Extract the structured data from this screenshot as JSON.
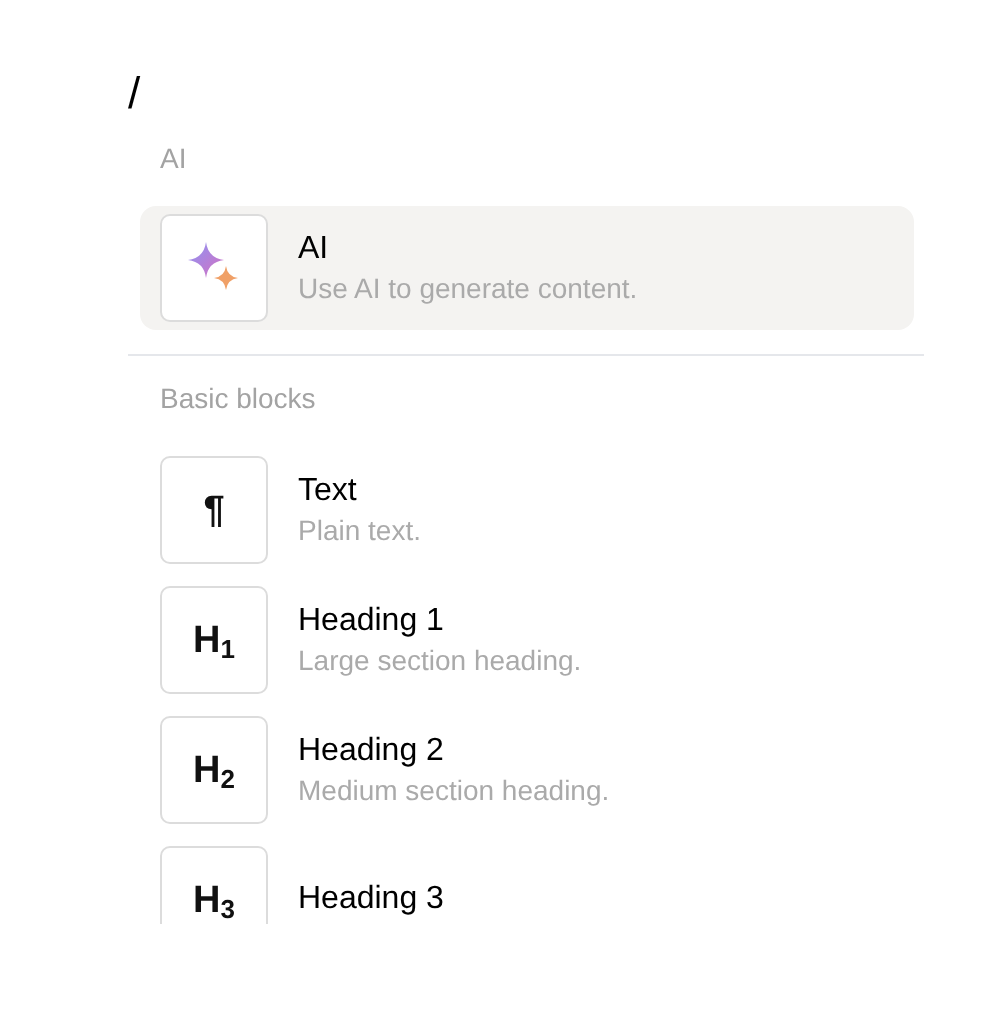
{
  "editor_text": "/",
  "sections": [
    {
      "title": "AI",
      "items": [
        {
          "kind": "ai",
          "title": "AI",
          "description": "Use AI to generate content.",
          "selected": true
        }
      ]
    },
    {
      "title": "Basic blocks",
      "items": [
        {
          "kind": "glyph",
          "glyph": "¶",
          "title": "Text",
          "description": "Plain text.",
          "selected": false
        },
        {
          "kind": "glyph",
          "glyph": "H$_{1}$",
          "title": "Heading 1",
          "description": "Large section heading.",
          "selected": false
        },
        {
          "kind": "glyph",
          "glyph": "H$_{2}$",
          "title": "Heading 2",
          "description": "Medium section heading.",
          "selected": false
        },
        {
          "kind": "glyph",
          "glyph": "H$_{3}$",
          "title": "Heading 3",
          "selected": false
        }
      ]
    }
  ]
}
